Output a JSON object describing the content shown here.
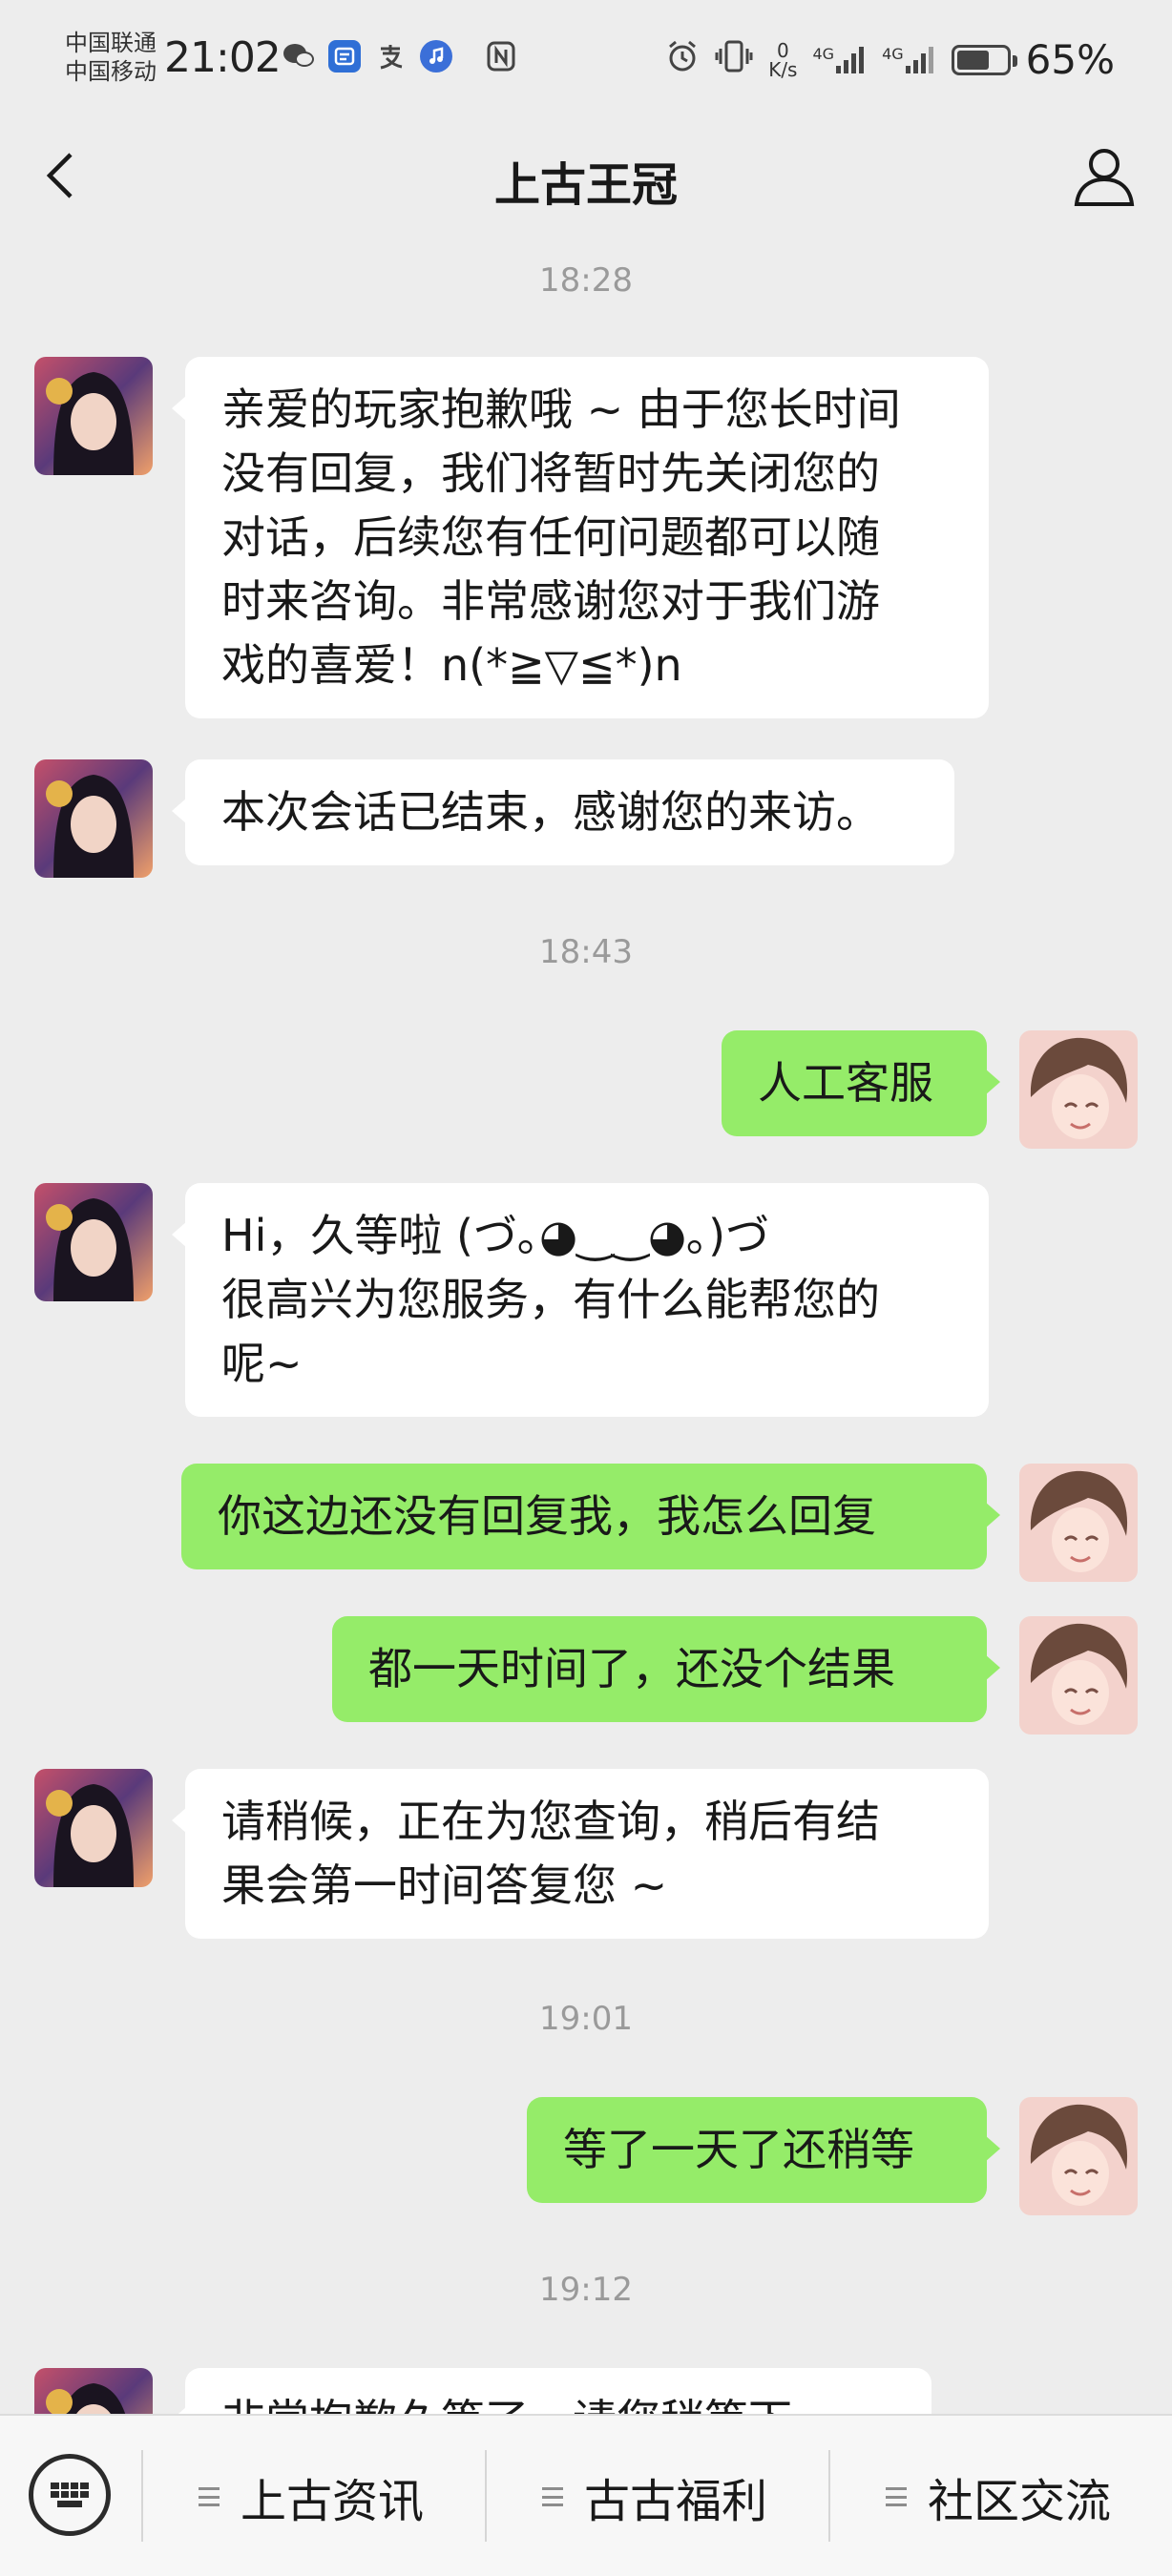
{
  "status_bar": {
    "carrier_1": "中国联通",
    "carrier_2": "中国移动",
    "time": "21:02",
    "net_speed_value": "0",
    "net_speed_unit": "K/s",
    "signal_1": "4G",
    "signal_2": "4G",
    "battery_percent": "65%",
    "battery_level": 0.65
  },
  "header": {
    "title": "上古王冠"
  },
  "chat": [
    {
      "type": "timestamp",
      "text": "18:28"
    },
    {
      "type": "message",
      "from": "agent",
      "lines": [
        "亲爱的玩家抱歉哦 ~ 由于您长时间",
        "没有回复，我们将暂时先关闭您的",
        "对话，后续您有任何问题都可以随",
        "时来咨询。非常感谢您对于我们游",
        "戏的喜爱！n(*≧▽≦*)n"
      ]
    },
    {
      "type": "message",
      "from": "agent",
      "lines": [
        "本次会话已结束，感谢您的来访。"
      ]
    },
    {
      "type": "timestamp",
      "text": "18:43"
    },
    {
      "type": "message",
      "from": "user",
      "lines": [
        "人工客服"
      ]
    },
    {
      "type": "message",
      "from": "agent",
      "lines": [
        "Hi，久等啦 (づ｡◕‿‿◕｡)づ",
        "很高兴为您服务，有什么能帮您的",
        "呢~"
      ]
    },
    {
      "type": "message",
      "from": "user",
      "lines": [
        "你这边还没有回复我，我怎么回复"
      ]
    },
    {
      "type": "message",
      "from": "user",
      "lines": [
        "都一天时间了，还没个结果"
      ]
    },
    {
      "type": "message",
      "from": "agent",
      "lines": [
        "请稍候，正在为您查询，稍后有结",
        "果会第一时间答复您 ~"
      ]
    },
    {
      "type": "timestamp",
      "text": "19:01"
    },
    {
      "type": "message",
      "from": "user",
      "lines": [
        "等了一天了还稍等"
      ]
    },
    {
      "type": "timestamp",
      "text": "19:12"
    },
    {
      "type": "message",
      "from": "agent",
      "lines": [
        "非常抱歉久等了，请您稍等下"
      ]
    }
  ],
  "bottom_menu": {
    "items": [
      {
        "label": "上古资讯"
      },
      {
        "label": "古古福利"
      },
      {
        "label": "社区交流"
      }
    ]
  },
  "colors": {
    "background": "#ededed",
    "incoming_bubble": "#ffffff",
    "outgoing_bubble": "#95ec69",
    "timestamp_text": "#9a9a9a"
  }
}
